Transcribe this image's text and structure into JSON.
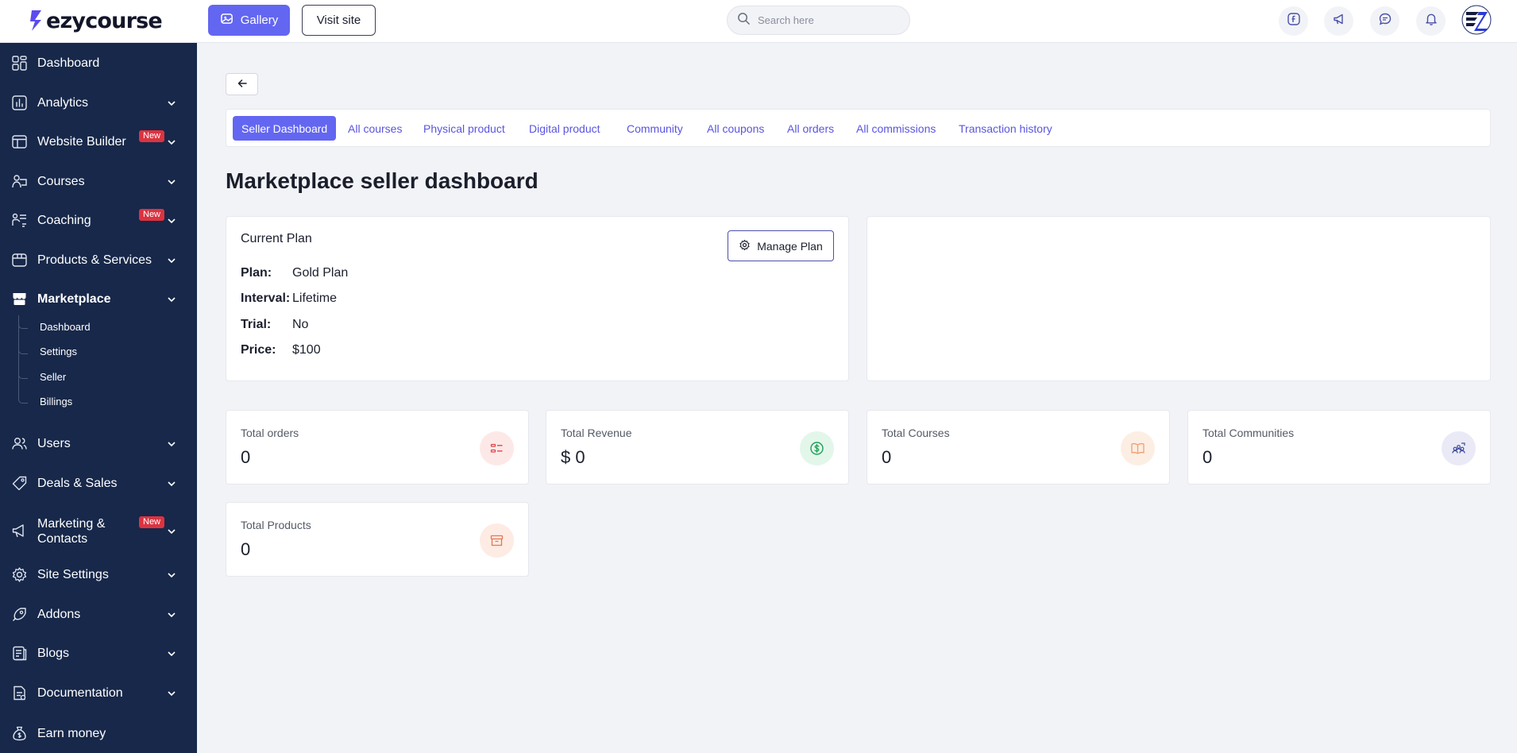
{
  "brand": {
    "name": "ezycourse"
  },
  "header": {
    "gallery_label": "Gallery",
    "visit_site_label": "Visit site",
    "search_placeholder": "Search here"
  },
  "sidebar": {
    "items": [
      {
        "label": "Dashboard",
        "icon": "dashboard-icon"
      },
      {
        "label": "Analytics",
        "icon": "analytics-icon"
      },
      {
        "label": "Website Builder",
        "icon": "website-builder-icon",
        "badge": "New"
      },
      {
        "label": "Courses",
        "icon": "courses-icon"
      },
      {
        "label": "Coaching",
        "icon": "coaching-icon",
        "badge": "New"
      },
      {
        "label": "Products & Services",
        "icon": "products-icon"
      },
      {
        "label": "Marketplace",
        "icon": "marketplace-icon"
      },
      {
        "label": "Users",
        "icon": "users-icon"
      },
      {
        "label": "Deals & Sales",
        "icon": "deals-icon"
      },
      {
        "label": "Marketing & Contacts",
        "icon": "marketing-icon",
        "badge": "New"
      },
      {
        "label": "Site Settings",
        "icon": "site-settings-icon"
      },
      {
        "label": "Addons",
        "icon": "addons-icon"
      },
      {
        "label": "Blogs",
        "icon": "blogs-icon"
      },
      {
        "label": "Documentation",
        "icon": "documentation-icon"
      },
      {
        "label": "Earn money",
        "icon": "earn-money-icon"
      }
    ],
    "marketplace_sub": [
      "Dashboard",
      "Settings",
      "Seller",
      "Billings"
    ],
    "marketing_line1": "Marketing &",
    "marketing_line2": "Contacts"
  },
  "tabs": [
    "Seller Dashboard",
    "All courses",
    "Physical product",
    "Digital product",
    "Community",
    "All coupons",
    "All orders",
    "All commissions",
    "Transaction history"
  ],
  "page": {
    "title": "Marketplace seller dashboard"
  },
  "plan": {
    "title": "Current Plan",
    "manage_label": "Manage Plan",
    "rows": [
      {
        "key": "Plan:",
        "value": "Gold Plan"
      },
      {
        "key": "Interval:",
        "value": "Lifetime"
      },
      {
        "key": "Trial:",
        "value": "No"
      },
      {
        "key": "Price:",
        "value": "$100"
      }
    ]
  },
  "stats": [
    {
      "label": "Total orders",
      "value": "0",
      "icon": "orders-icon",
      "bg": "#fde8e8",
      "color": "#e0464a"
    },
    {
      "label": "Total Revenue",
      "value": "$ 0",
      "icon": "dollar-icon",
      "bg": "#e3f6ea",
      "color": "#1e9e55"
    },
    {
      "label": "Total Courses",
      "value": "0",
      "icon": "book-icon",
      "bg": "#fdeee4",
      "color": "#f0a070"
    },
    {
      "label": "Total Communities",
      "value": "0",
      "icon": "community-icon",
      "bg": "#e9eaf6",
      "color": "#3d4a9c"
    },
    {
      "label": "Total Products",
      "value": "0",
      "icon": "product-box-icon",
      "bg": "#fdebe4",
      "color": "#e2784f"
    }
  ],
  "colors": {
    "accent": "#6366f1",
    "sidebar": "#17284a",
    "badge": "#dc3340"
  }
}
